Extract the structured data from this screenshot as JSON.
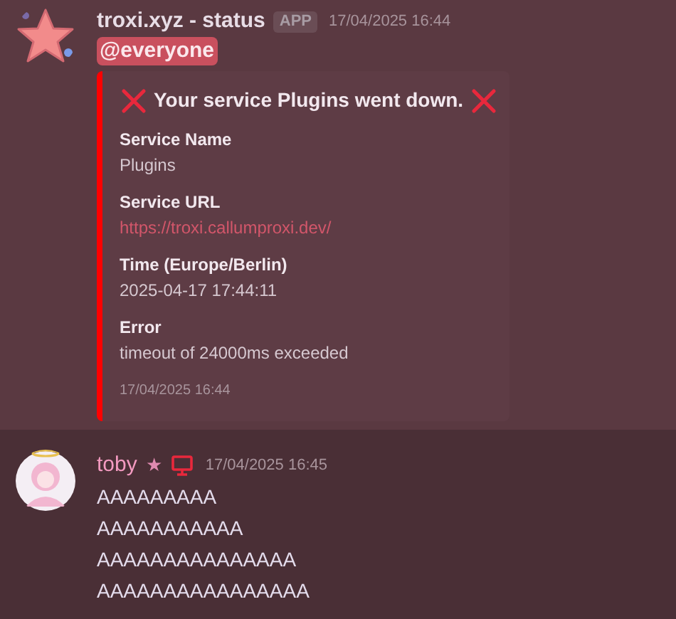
{
  "messages": [
    {
      "author": "troxi.xyz - status",
      "badge": "APP",
      "timestamp": "17/04/2025 16:44",
      "highlighted": true,
      "avatar": {
        "kind": "star"
      },
      "mention": "@everyone",
      "embed": {
        "color": "#ff0000",
        "title": "Your service Plugins went down.",
        "fields": [
          {
            "name": "Service Name",
            "value": "Plugins",
            "kind": "text"
          },
          {
            "name": "Service URL",
            "value": "https://troxi.callumproxi.dev/",
            "kind": "link"
          },
          {
            "name": "Time (Europe/Berlin)",
            "value": "2025-04-17 17:44:11",
            "kind": "text"
          },
          {
            "name": "Error",
            "value": "timeout of 24000ms exceeded",
            "kind": "text"
          }
        ],
        "footer": "17/04/2025 16:44"
      }
    },
    {
      "author": "toby",
      "author_mark": "★",
      "timestamp": "17/04/2025 16:45",
      "highlighted": false,
      "avatar": {
        "kind": "person"
      },
      "platform_icon": {
        "kind": "desktop"
      },
      "lines": [
        "AAAAAAAAA",
        "AAAAAAAAAAA",
        "AAAAAAAAAAAAAAA",
        "AAAAAAAAAAAAAAAA"
      ]
    }
  ]
}
